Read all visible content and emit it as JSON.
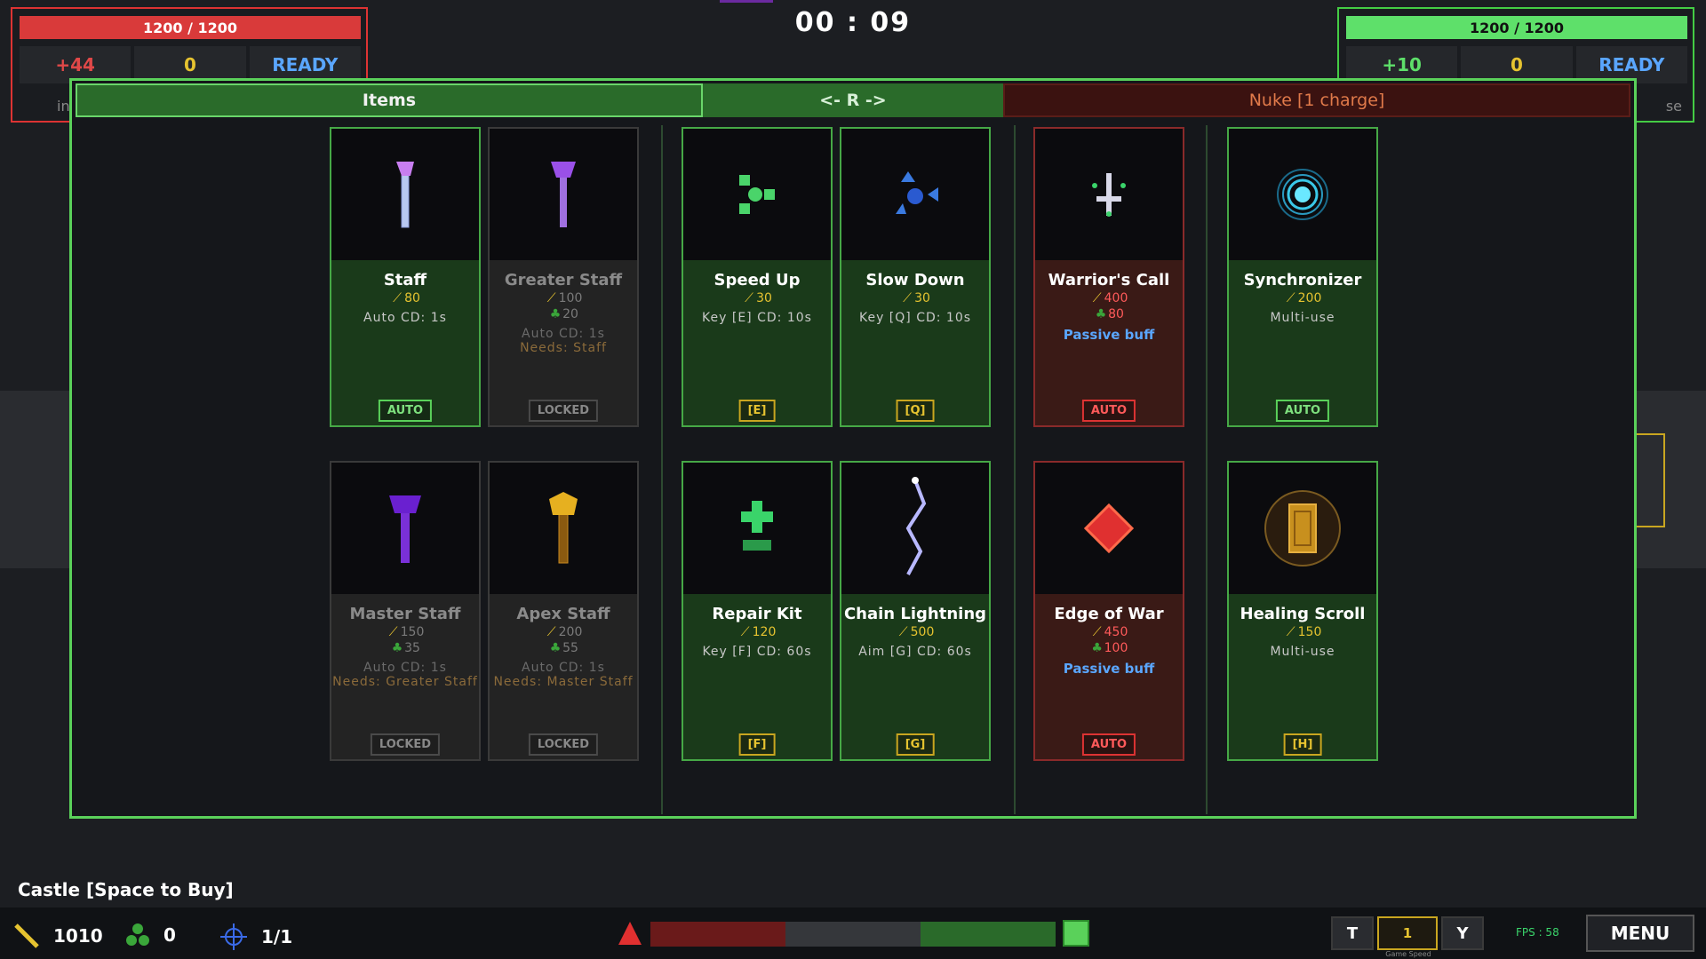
{
  "timer": "00 : 09",
  "left_player": {
    "hp": "1200 / 1200",
    "stat1": "+44",
    "stat2": "0",
    "status": "READY",
    "partial": "in"
  },
  "right_player": {
    "hp": "1200 / 1200",
    "stat1": "+10",
    "stat2": "0",
    "status": "READY",
    "partial": "se"
  },
  "colors": {
    "accent_green": "#5ad15a",
    "danger_red": "#d93a3a",
    "gold": "#e6c330",
    "blue": "#5aa6ff"
  },
  "tabs": {
    "items": "Items",
    "switch": "<- R ->",
    "nuke": "Nuke  [1 charge]"
  },
  "cards": {
    "staff": {
      "name": "Staff",
      "cost_gold": "80",
      "meta": "Auto   CD: 1s",
      "badge": "AUTO",
      "icon": "staff-icon"
    },
    "greater_staff": {
      "name": "Greater Staff",
      "cost_gold": "100",
      "cost_green": "20",
      "meta": "Auto   CD: 1s",
      "needs": "Needs: Staff",
      "badge": "LOCKED",
      "icon": "greater-staff-icon"
    },
    "master_staff": {
      "name": "Master Staff",
      "cost_gold": "150",
      "cost_green": "35",
      "meta": "Auto   CD: 1s",
      "needs": "Needs: Greater Staff",
      "badge": "LOCKED",
      "icon": "master-staff-icon"
    },
    "apex_staff": {
      "name": "Apex Staff",
      "cost_gold": "200",
      "cost_green": "55",
      "meta": "Auto   CD: 1s",
      "needs": "Needs: Master Staff",
      "badge": "LOCKED",
      "icon": "apex-staff-icon"
    },
    "speed_up": {
      "name": "Speed Up",
      "cost_gold": "30",
      "meta": "Key [E]   CD: 10s",
      "badge": "[E]",
      "icon": "speed-up-icon"
    },
    "slow_down": {
      "name": "Slow Down",
      "cost_gold": "30",
      "meta": "Key [Q]   CD: 10s",
      "badge": "[Q]",
      "icon": "slow-down-icon"
    },
    "repair_kit": {
      "name": "Repair Kit",
      "cost_gold": "120",
      "meta": "Key [F]   CD: 60s",
      "badge": "[F]",
      "icon": "repair-kit-icon"
    },
    "chain_lightning": {
      "name": "Chain Lightning",
      "cost_gold": "500",
      "meta": "Aim [G]   CD: 60s",
      "badge": "[G]",
      "icon": "chain-lightning-icon"
    },
    "warriors_call": {
      "name": "Warrior's Call",
      "cost_gold": "400",
      "cost_green": "80",
      "passive": "Passive buff",
      "badge": "AUTO",
      "icon": "warriors-call-icon"
    },
    "edge_of_war": {
      "name": "Edge of War",
      "cost_gold": "450",
      "cost_green": "100",
      "passive": "Passive buff",
      "badge": "AUTO",
      "icon": "edge-of-war-icon"
    },
    "synchronizer": {
      "name": "Synchronizer",
      "cost_gold": "200",
      "meta": "Multi-use",
      "badge": "AUTO",
      "icon": "synchronizer-icon"
    },
    "healing_scroll": {
      "name": "Healing Scroll",
      "cost_gold": "150",
      "meta": "Multi-use",
      "badge": "[H]",
      "icon": "healing-scroll-icon"
    }
  },
  "bottom": {
    "castle_label": "Castle  [Space to Buy]",
    "gold": "1010",
    "green": "0",
    "units": "1/1",
    "speed_t": "T",
    "speed_value": "1",
    "speed_y": "Y",
    "speed_caption": "Game Speed",
    "fps": "FPS : 58",
    "menu": "MENU"
  }
}
